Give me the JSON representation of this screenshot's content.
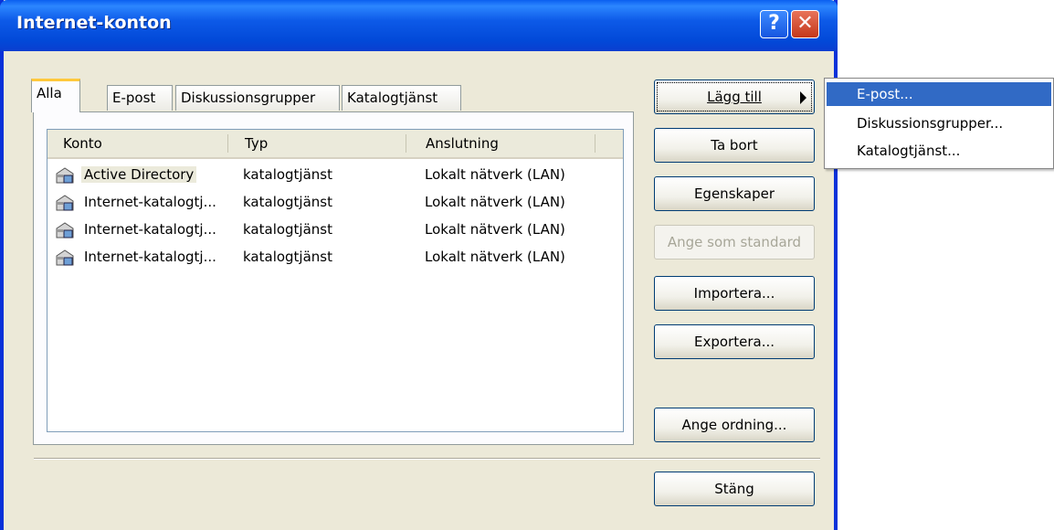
{
  "window": {
    "title": "Internet-konton"
  },
  "titlebar": {
    "help_label": "?",
    "close_label": "✕"
  },
  "tabs": [
    {
      "label": "Alla",
      "active": true
    },
    {
      "label": "E-post",
      "active": false
    },
    {
      "label": "Diskussionsgrupper",
      "active": false
    },
    {
      "label": "Katalogtjänst",
      "active": false
    }
  ],
  "list": {
    "columns": [
      "Konto",
      "Typ",
      "Anslutning"
    ],
    "rows": [
      {
        "konto": "Active Directory",
        "typ": "katalogtjänst",
        "anslutning": "Lokalt nätverk (LAN)",
        "icon": "directory-server-icon"
      },
      {
        "konto": "Internet-katalogtj...",
        "typ": "katalogtjänst",
        "anslutning": "Lokalt nätverk (LAN)",
        "icon": "directory-server-icon"
      },
      {
        "konto": "Internet-katalogtj...",
        "typ": "katalogtjänst",
        "anslutning": "Lokalt nätverk (LAN)",
        "icon": "directory-server-icon"
      },
      {
        "konto": "Internet-katalogtj...",
        "typ": "katalogtjänst",
        "anslutning": "Lokalt nätverk (LAN)",
        "icon": "directory-server-icon"
      }
    ]
  },
  "buttons": {
    "add": "Lägg till",
    "remove": "Ta bort",
    "properties": "Egenskaper",
    "set_default": "Ange som standard",
    "import": "Importera...",
    "export": "Exportera...",
    "set_order": "Ange ordning...",
    "close": "Stäng"
  },
  "submenu": {
    "items": [
      "E-post...",
      "Diskussionsgrupper...",
      "Katalogtjänst..."
    ],
    "selected_index": 0
  },
  "colors": {
    "titlebar": "#0a5ff0",
    "selection": "#316ac5",
    "dialog_bg": "#ece9d8"
  }
}
